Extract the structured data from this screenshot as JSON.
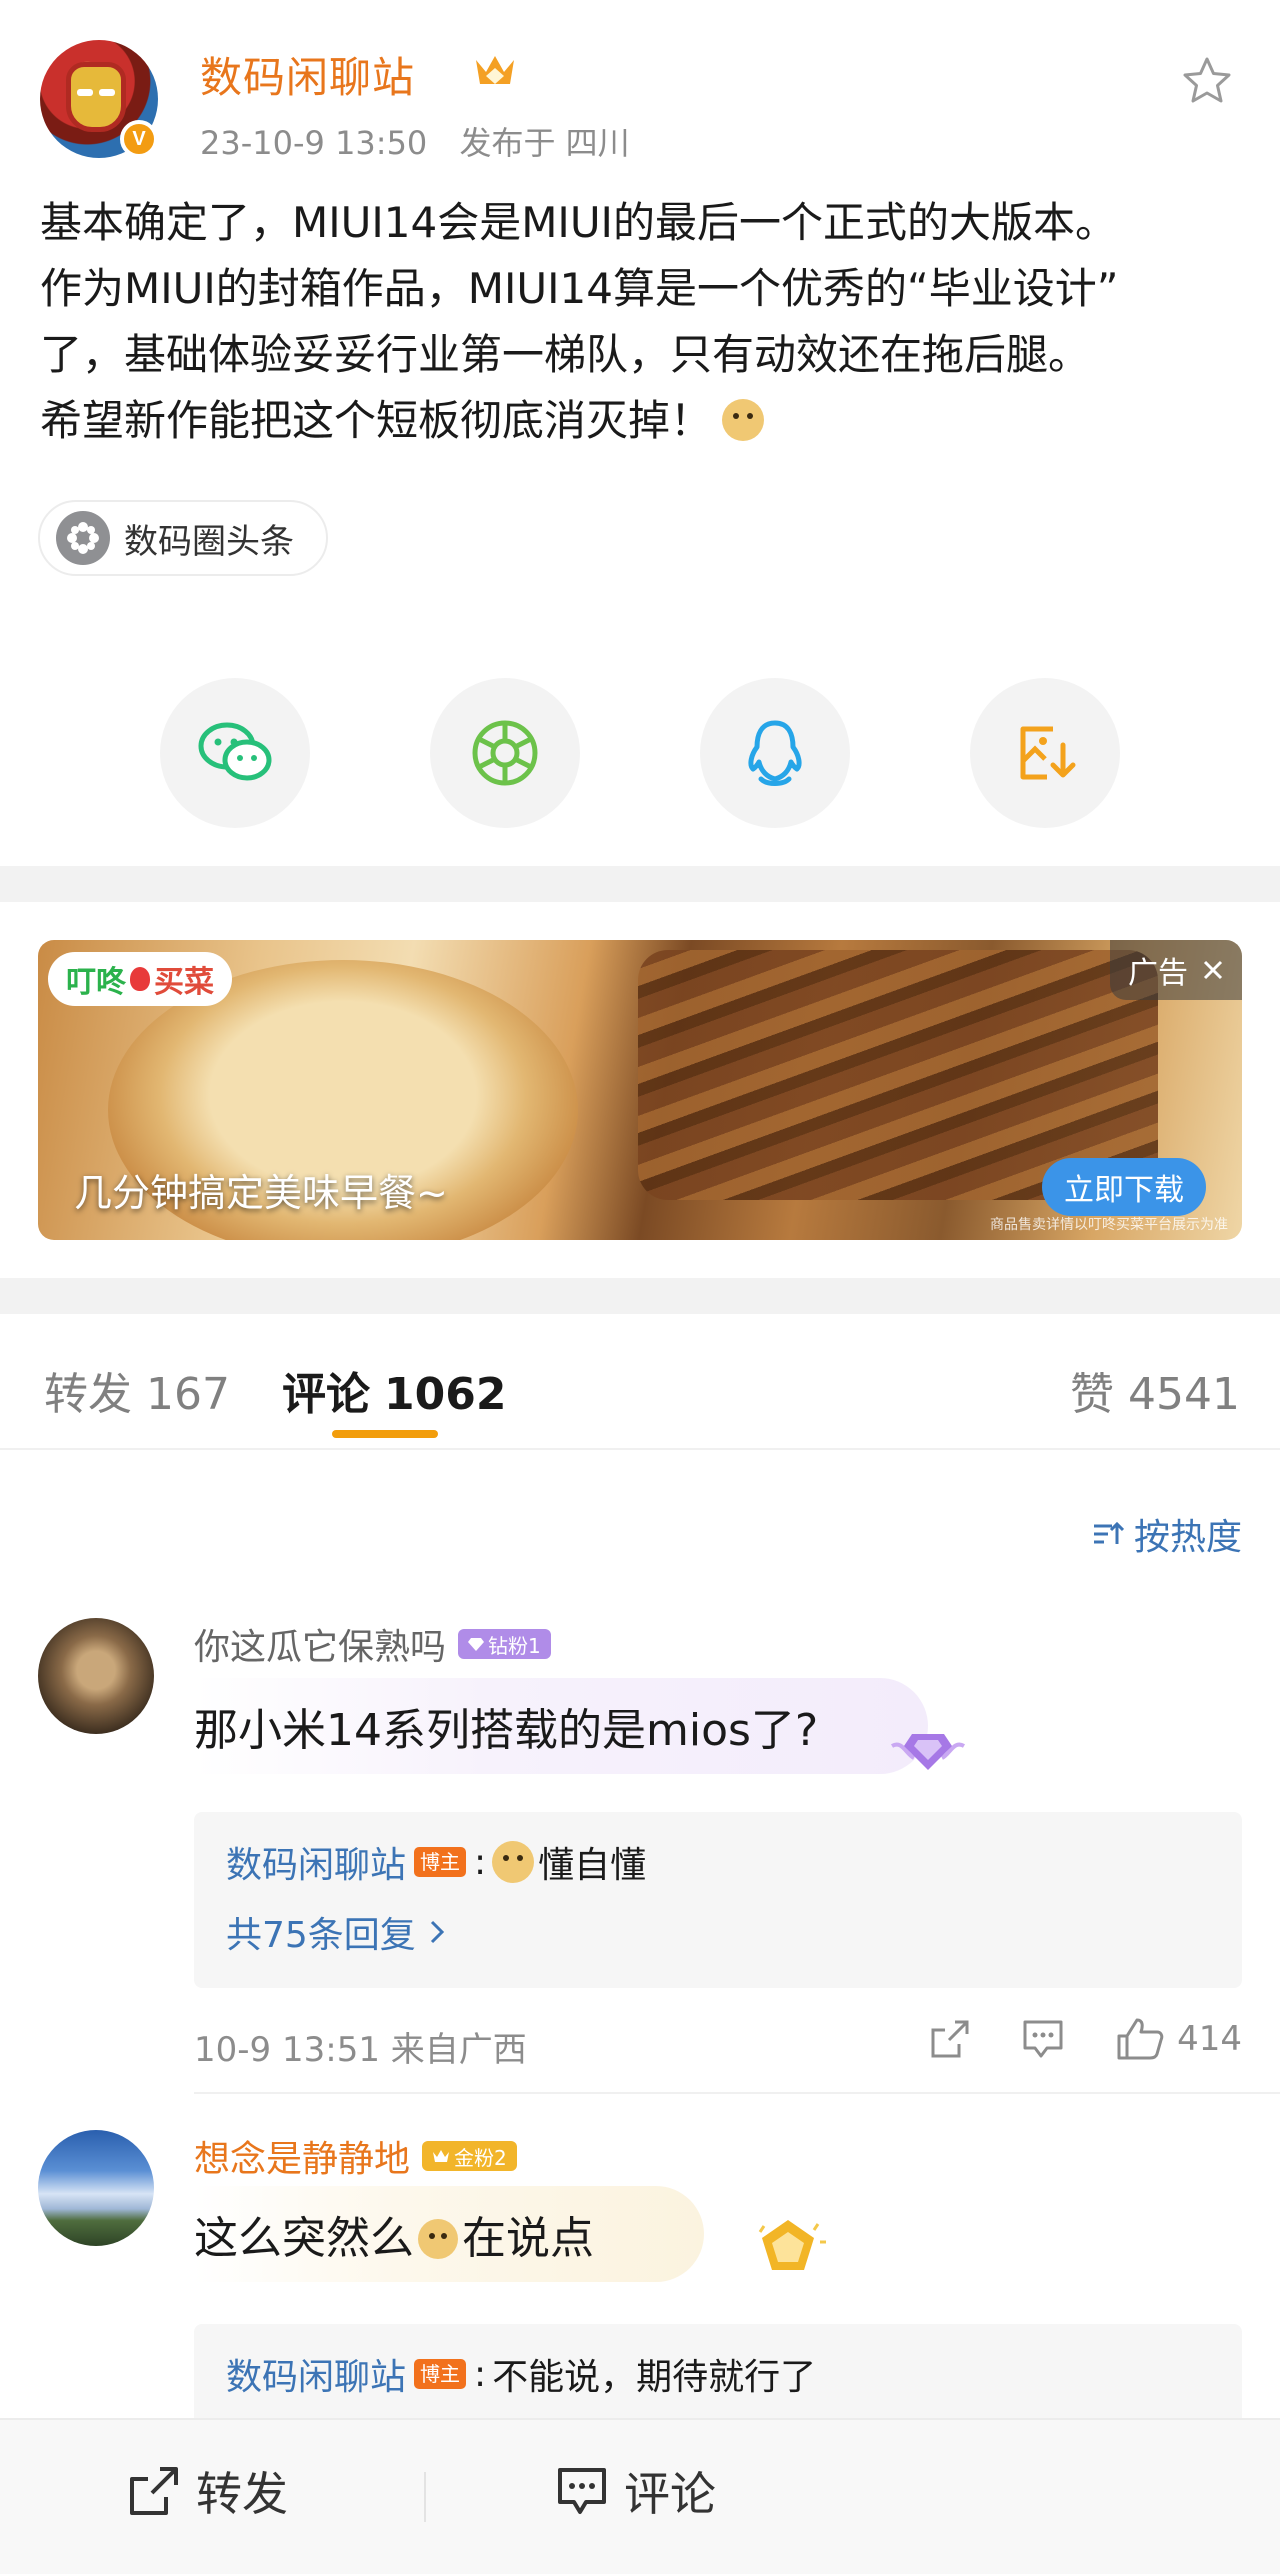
{
  "post": {
    "author": "数码闲聊站",
    "verified_mark": "V",
    "date": "23-10-9 13:50",
    "location": "发布于 四川",
    "lines": [
      "基本确定了，MIUI14会是MIUI的最后一个正式的大版本。",
      "作为MIUI的封箱作品，MIUI14算是一个优秀的“毕业设计”",
      "了，基础体验妥妥行业第一梯队，只有动效还在拖后腿。",
      "希望新作能把这个短板彻底消灭掉！"
    ],
    "topic": "数码圈头条"
  },
  "share": {
    "icons": [
      "wechat-icon",
      "moments-icon",
      "qq-icon",
      "save-image-icon"
    ]
  },
  "ad": {
    "brand_prefix": "叮咚",
    "brand_suffix": "买菜",
    "tag": "广告",
    "caption": "几分钟搞定美味早餐~",
    "cta": "立即下载",
    "footnote": "商品售卖详情以叮咚买菜平台展示为准"
  },
  "tabs": {
    "repost_label": "转发",
    "repost_count": "167",
    "comment_label": "评论",
    "comment_count": "1062",
    "like_label": "赞",
    "like_count": "4541"
  },
  "sort_label": "按热度",
  "comments": [
    {
      "user": "你这瓜它保熟吗",
      "badge": "钻粉1",
      "text": "那小米14系列搭载的是mios了?",
      "reply_author": "数码闲聊站",
      "reply_tag": "博主",
      "reply_text": "懂自懂",
      "reply_more": "共75条回复",
      "meta": "10-9 13:51  来自广西",
      "likes": "414"
    },
    {
      "user": "想念是静静地",
      "badge": "金粉2",
      "text_before": "这么突然么",
      "text_after": "在说点",
      "reply_author": "数码闲聊站",
      "reply_tag": "博主",
      "reply_text": "不能说，期待就行了"
    }
  ],
  "bottom": {
    "repost": "转发",
    "comment": "评论"
  },
  "colors": {
    "accent": "#f29d0c",
    "link": "#3c74b5",
    "author": "#e8761c"
  }
}
